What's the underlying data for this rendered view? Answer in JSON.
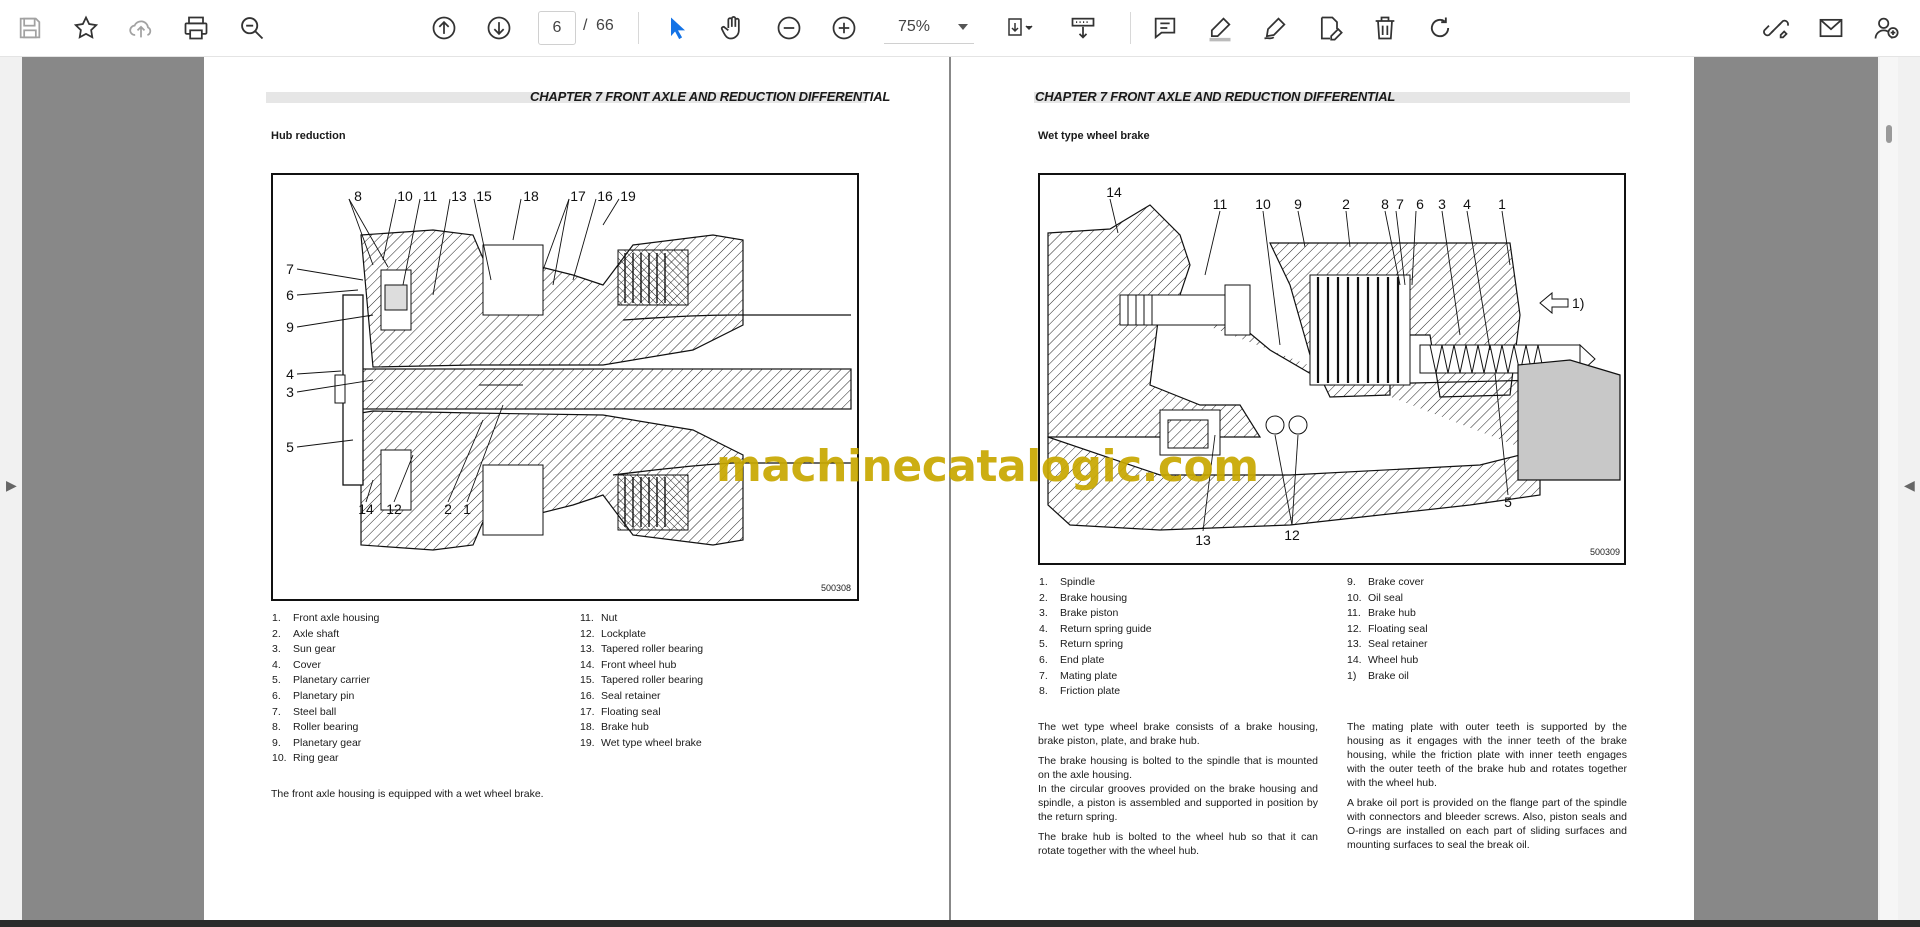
{
  "toolbar": {
    "page_current": "6",
    "page_separator": "/",
    "page_total": "66",
    "zoom": "75%"
  },
  "left_page": {
    "chapter": "CHAPTER 7 FRONT AXLE AND REDUCTION DIFFERENTIAL",
    "section": "Hub reduction",
    "figure_code": "500308",
    "figure_labels": [
      "8",
      "10",
      "11",
      "13",
      "15",
      "18",
      "17",
      "16",
      "19",
      "7",
      "6",
      "9",
      "4",
      "3",
      "5",
      "14",
      "12",
      "2",
      "1"
    ],
    "parts_col1": [
      {
        "n": "1.",
        "t": "Front axle housing"
      },
      {
        "n": "2.",
        "t": "Axle shaft"
      },
      {
        "n": "3.",
        "t": "Sun gear"
      },
      {
        "n": "4.",
        "t": "Cover"
      },
      {
        "n": "5.",
        "t": "Planetary carrier"
      },
      {
        "n": "6.",
        "t": "Planetary pin"
      },
      {
        "n": "7.",
        "t": "Steel ball"
      },
      {
        "n": "8.",
        "t": "Roller bearing"
      },
      {
        "n": "9.",
        "t": "Planetary gear"
      },
      {
        "n": "10.",
        "t": "Ring gear"
      }
    ],
    "parts_col2": [
      {
        "n": "11.",
        "t": "Nut"
      },
      {
        "n": "12.",
        "t": "Lockplate"
      },
      {
        "n": "13.",
        "t": "Tapered roller bearing"
      },
      {
        "n": "14.",
        "t": "Front wheel hub"
      },
      {
        "n": "15.",
        "t": "Tapered roller bearing"
      },
      {
        "n": "16.",
        "t": "Seal retainer"
      },
      {
        "n": "17.",
        "t": "Floating seal"
      },
      {
        "n": "18.",
        "t": "Brake hub"
      },
      {
        "n": "19.",
        "t": "Wet type wheel brake"
      }
    ],
    "body": "The front axle housing is equipped with a wet wheel brake."
  },
  "right_page": {
    "chapter": "CHAPTER 7 FRONT AXLE AND REDUCTION DIFFERENTIAL",
    "section": "Wet type wheel brake",
    "figure_code": "500309",
    "figure_labels": [
      "14",
      "11",
      "10",
      "9",
      "2",
      "8",
      "7",
      "6",
      "3",
      "4",
      "1",
      "1)",
      "5",
      "13",
      "12"
    ],
    "parts_col1": [
      {
        "n": "1.",
        "t": "Spindle"
      },
      {
        "n": "2.",
        "t": "Brake housing"
      },
      {
        "n": "3.",
        "t": "Brake piston"
      },
      {
        "n": "4.",
        "t": "Return spring guide"
      },
      {
        "n": "5.",
        "t": "Return spring"
      },
      {
        "n": "6.",
        "t": "End plate"
      },
      {
        "n": "7.",
        "t": "Mating plate"
      },
      {
        "n": "8.",
        "t": "Friction plate"
      }
    ],
    "parts_col2": [
      {
        "n": "9.",
        "t": "Brake cover"
      },
      {
        "n": "10.",
        "t": "Oil seal"
      },
      {
        "n": "11.",
        "t": "Brake hub"
      },
      {
        "n": "12.",
        "t": "Floating seal"
      },
      {
        "n": "13.",
        "t": "Seal retainer"
      },
      {
        "n": "14.",
        "t": "Wheel hub"
      },
      {
        "n": "1)",
        "t": "Brake oil"
      }
    ],
    "body_col1": [
      "The wet type wheel brake consists of a brake housing, brake piston, plate, and brake hub.",
      "The brake housing is bolted to the spindle that is mounted on the axle housing.",
      "In the circular grooves provided on the brake housing and spindle, a piston is assembled and supported in position by the return spring.",
      "The brake hub is bolted to the wheel hub so that it can rotate together with the wheel hub."
    ],
    "body_col2": [
      "The mating plate with outer teeth is supported by the housing as it engages with the inner teeth of the brake housing, while the friction plate with inner teeth engages with the outer teeth of the brake hub and rotates together with the wheel hub.",
      "A brake oil port is provided on the flange part of the spindle with connectors and bleeder screws. Also, piston seals and O-rings are installed on each part of sliding surfaces and mounting surfaces to seal the break oil."
    ]
  },
  "watermark": "machinecatalogic.com"
}
